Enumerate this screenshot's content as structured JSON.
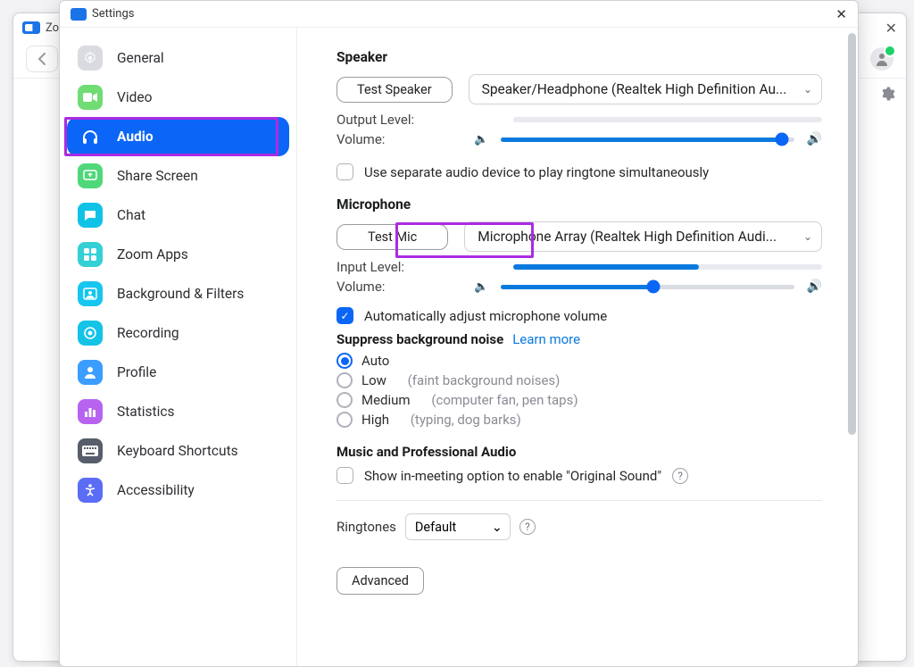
{
  "bg": {
    "title": "Zoo"
  },
  "window": {
    "title": "Settings"
  },
  "sidebar": {
    "items": [
      {
        "label": "General"
      },
      {
        "label": "Video"
      },
      {
        "label": "Audio"
      },
      {
        "label": "Share Screen"
      },
      {
        "label": "Chat"
      },
      {
        "label": "Zoom Apps"
      },
      {
        "label": "Background & Filters"
      },
      {
        "label": "Recording"
      },
      {
        "label": "Profile"
      },
      {
        "label": "Statistics"
      },
      {
        "label": "Keyboard Shortcuts"
      },
      {
        "label": "Accessibility"
      }
    ]
  },
  "speaker": {
    "heading": "Speaker",
    "test_label": "Test Speaker",
    "device": "Speaker/Headphone (Realtek High Definition Au...",
    "output_label": "Output Level:",
    "volume_label": "Volume:",
    "volume_pct": 96
  },
  "speaker_sep": {
    "label": "Use separate audio device to play ringtone simultaneously"
  },
  "mic": {
    "heading": "Microphone",
    "test_label": "Test Mic",
    "device": "Microphone Array (Realtek High Definition Audi...",
    "input_label": "Input Level:",
    "input_pct": 60,
    "volume_label": "Volume:",
    "volume_pct": 52,
    "auto_adjust": "Automatically adjust microphone volume"
  },
  "suppress": {
    "heading": "Suppress background noise",
    "learn_more": "Learn more",
    "options": [
      {
        "label": "Auto",
        "hint": ""
      },
      {
        "label": "Low",
        "hint": "(faint background noises)"
      },
      {
        "label": "Medium",
        "hint": "(computer fan, pen taps)"
      },
      {
        "label": "High",
        "hint": "(typing, dog barks)"
      }
    ]
  },
  "music": {
    "heading": "Music and Professional Audio",
    "original_sound": "Show in-meeting option to enable \"Original Sound\""
  },
  "ringtones": {
    "label": "Ringtones",
    "value": "Default"
  },
  "advanced": {
    "label": "Advanced"
  }
}
